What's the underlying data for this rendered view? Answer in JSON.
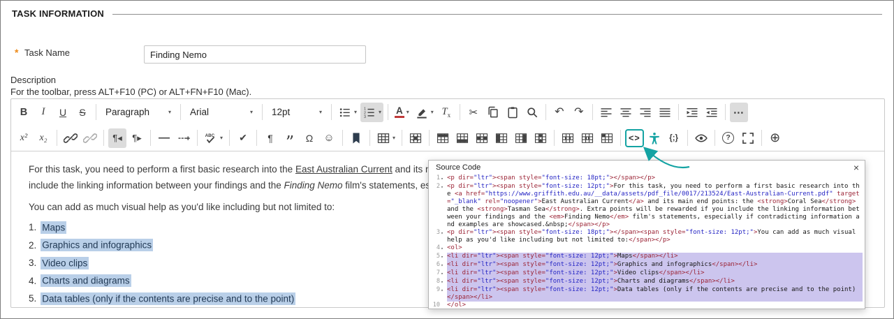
{
  "colors": {
    "teal": "#14a3a3",
    "selection_blue": "#b9cfe8",
    "selection_lavender": "#ccc5ee",
    "asterisk": "#ed8a19",
    "code_tag": "#9b2335",
    "code_string": "#2525c4"
  },
  "header": {
    "title": "TASK INFORMATION"
  },
  "task_name": {
    "required_mark": "*",
    "label": "Task Name",
    "value": "Finding Nemo"
  },
  "description": {
    "label": "Description",
    "toolbar_hint": "For the toolbar, press ALT+F10 (PC) or ALT+FN+F10 (Mac)."
  },
  "toolbar": {
    "row1": [
      {
        "name": "bold-button",
        "glyph": "B",
        "cls": "bold"
      },
      {
        "name": "italic-button",
        "glyph": "I",
        "cls": "italic"
      },
      {
        "name": "underline-button",
        "glyph": "U",
        "cls": "underline"
      },
      {
        "name": "strikethrough-button",
        "glyph": "S",
        "cls": "strike"
      },
      {
        "divider": true
      },
      {
        "name": "paragraph-format-select",
        "label": "Paragraph",
        "select": true
      },
      {
        "divider": true
      },
      {
        "name": "font-family-select",
        "label": "Arial",
        "select": true
      },
      {
        "divider": true
      },
      {
        "name": "font-size-select",
        "label": "12pt",
        "select": true
      },
      {
        "divider": true
      },
      {
        "name": "bullet-list-button",
        "icon": "ul",
        "dropdown": true
      },
      {
        "name": "numbered-list-button",
        "icon": "ol",
        "dropdown": true,
        "active": true
      },
      {
        "divider": true
      },
      {
        "name": "text-color-button",
        "glyph": "A",
        "cls": "textcolor",
        "dropdown": true
      },
      {
        "name": "highlight-color-button",
        "icon": "highlight",
        "dropdown": true
      },
      {
        "name": "clear-formatting-button",
        "glyph": "T",
        "sub": "x",
        "cls": "clearfmt"
      },
      {
        "divider": true
      },
      {
        "name": "cut-button",
        "glyph": "✂",
        "cls": "scissors"
      },
      {
        "name": "copy-button",
        "icon": "copy"
      },
      {
        "name": "paste-button",
        "icon": "paste"
      },
      {
        "name": "search-button",
        "icon": "search"
      },
      {
        "divider": true
      },
      {
        "name": "undo-button",
        "glyph": "↶",
        "cls": "arrowg"
      },
      {
        "name": "redo-button",
        "glyph": "↷",
        "cls": "arrowg"
      },
      {
        "divider": true
      },
      {
        "name": "align-left-button",
        "icon": "alignleft"
      },
      {
        "name": "align-center-button",
        "icon": "aligncenter"
      },
      {
        "name": "align-right-button",
        "icon": "alignright"
      },
      {
        "name": "align-justify-button",
        "icon": "alignjustify"
      },
      {
        "divider": true
      },
      {
        "name": "indent-button",
        "icon": "indent"
      },
      {
        "name": "outdent-button",
        "icon": "outdent"
      },
      {
        "divider": true
      },
      {
        "name": "more-toolbar-button",
        "glyph": "⋯",
        "cls": "more",
        "active": true
      }
    ],
    "row2": [
      {
        "name": "superscript-button",
        "glyph": "x²",
        "cls": "formula"
      },
      {
        "name": "subscript-button",
        "glyph": "x₂",
        "cls": "formula"
      },
      {
        "divider": true
      },
      {
        "name": "insert-link-button",
        "icon": "link"
      },
      {
        "name": "remove-link-button",
        "icon": "unlink",
        "cls": "disabled"
      },
      {
        "divider": true
      },
      {
        "name": "ltr-direction-button",
        "glyph": "¶◂",
        "cls": "dir",
        "active": true
      },
      {
        "name": "rtl-direction-button",
        "glyph": "¶▸",
        "cls": "dir"
      },
      {
        "divider": true
      },
      {
        "name": "horizontal-rule-button",
        "glyph": "—",
        "cls": "hrline"
      },
      {
        "name": "page-break-button",
        "icon": "pagebreak"
      },
      {
        "divider": true
      },
      {
        "name": "spellcheck-button",
        "icon": "spellcheck",
        "dropdown": true
      },
      {
        "divider": true
      },
      {
        "name": "checkmark-button",
        "glyph": "✔"
      },
      {
        "divider": true
      },
      {
        "name": "show-invisibles-button",
        "glyph": "¶"
      },
      {
        "name": "blockquote-button",
        "glyph": "”",
        "cls": "quote"
      },
      {
        "name": "special-character-button",
        "glyph": "Ω"
      },
      {
        "name": "emoticon-button",
        "glyph": "☺",
        "cls": "smiley"
      },
      {
        "divider": true
      },
      {
        "name": "anchor-button",
        "icon": "bookmark",
        "cls": "inkdark"
      },
      {
        "divider": true
      },
      {
        "name": "table-button",
        "icon": "table",
        "dropdown": true
      },
      {
        "divider": true
      },
      {
        "name": "delete-table-button",
        "icon": "tabledel"
      },
      {
        "divider": true
      },
      {
        "name": "insert-row-above-button",
        "icon": "rowabove"
      },
      {
        "name": "insert-row-below-button",
        "icon": "rowbelow"
      },
      {
        "name": "delete-row-button",
        "icon": "rowdel"
      },
      {
        "name": "insert-column-before-button",
        "icon": "colbefore"
      },
      {
        "name": "insert-column-after-button",
        "icon": "colafter"
      },
      {
        "name": "delete-column-button",
        "icon": "coldel"
      },
      {
        "divider": true
      },
      {
        "name": "merge-cells-button",
        "icon": "merge"
      },
      {
        "name": "split-cell-button",
        "icon": "split"
      },
      {
        "name": "cell-properties-button",
        "icon": "cellprops"
      },
      {
        "divider": true
      },
      {
        "name": "source-code-button",
        "glyph": "<>",
        "cls": "srccode",
        "teal": true
      },
      {
        "name": "accessibility-checker-button",
        "icon": "person",
        "cls": "teal-icon"
      },
      {
        "name": "code-sample-button",
        "glyph": "{;}",
        "cls": "codesample"
      },
      {
        "divider": true
      },
      {
        "name": "preview-button",
        "icon": "eye"
      },
      {
        "divider": true
      },
      {
        "name": "help-button",
        "glyph": "?",
        "cls": "circled"
      },
      {
        "name": "fullscreen-button",
        "icon": "fullscreen"
      },
      {
        "divider": true
      },
      {
        "name": "insert-button",
        "glyph": "⊕",
        "cls": "big"
      }
    ]
  },
  "editor_content": {
    "paragraph1_line1": [
      {
        "t": "For this task, you need to perform a first basic research into the "
      },
      {
        "t": "East Australian Current",
        "s": "link"
      },
      {
        "t": " and its main end points: the "
      },
      {
        "t": "Coral Sea",
        "s": "bold"
      },
      {
        "t": " and the "
      },
      {
        "t": "Tasman Sea",
        "s": "bold"
      },
      {
        "t": ". Extra points will be rewarded if you"
      }
    ],
    "paragraph1_line2": [
      {
        "t": "include the linking information between your findings and the "
      },
      {
        "t": "Finding Nemo",
        "s": "italic"
      },
      {
        "t": " film's statements, especially if contradicting information and examples are showcased."
      }
    ],
    "paragraph2": "You can add as much visual help as you'd like including but not limited to:",
    "list": [
      {
        "num": "1.",
        "text": "Maps"
      },
      {
        "num": "2.",
        "text": "Graphics and infographics"
      },
      {
        "num": "3.",
        "text": "Video clips"
      },
      {
        "num": "4.",
        "text": "Charts and diagrams"
      },
      {
        "num": "5.",
        "text": "Data tables (only if the contents are precise and to the point)"
      }
    ]
  },
  "source_code_panel": {
    "title": "Source Code",
    "close_label": "×",
    "lines": [
      {
        "n": 1,
        "fold": true,
        "selected": false,
        "code": "<p dir=\"ltr\"><span style=\"font-size: 18pt;\"></span></p>"
      },
      {
        "n": 2,
        "fold": true,
        "selected": false,
        "code": "<p dir=\"ltr\"><span style=\"font-size: 12pt;\">For this task, you need to perform a first basic research into the <a href=\"https://www.griffith.edu.au/__data/assets/pdf_file/0017/213524/East-Australian-Current.pdf\" target=\"_blank\" rel=\"noopener\">East Australian Current</a> and its main end points: the <strong>Coral Sea</strong> and the <strong>Tasman Sea</strong>. Extra points will be rewarded if you include the linking information between your findings and the <em>Finding Nemo</em> film's statements, especially if contradicting information and examples are showcased.&nbsp;</span></p>"
      },
      {
        "n": 3,
        "fold": true,
        "selected": false,
        "code": "<p dir=\"ltr\"><span style=\"font-size: 18pt;\"></span><span style=\"font-size: 12pt;\">You can add as much visual help as you'd like including but not limited to:</span></p>"
      },
      {
        "n": 4,
        "fold": true,
        "selected": false,
        "code": "<ol>"
      },
      {
        "n": 5,
        "fold": true,
        "selected": true,
        "code": "<li dir=\"ltr\"><span style=\"font-size: 12pt;\">Maps</span></li>"
      },
      {
        "n": 6,
        "fold": true,
        "selected": true,
        "code": "<li dir=\"ltr\"><span style=\"font-size: 12pt;\">Graphics and infographics</span></li>"
      },
      {
        "n": 7,
        "fold": true,
        "selected": true,
        "code": "<li dir=\"ltr\"><span style=\"font-size: 12pt;\">Video clips</span></li>"
      },
      {
        "n": 8,
        "fold": true,
        "selected": true,
        "code": "<li dir=\"ltr\"><span style=\"font-size: 12pt;\">Charts and diagrams</span></li>"
      },
      {
        "n": 9,
        "fold": true,
        "selected": true,
        "code": "<li dir=\"ltr\"><span style=\"font-size: 12pt;\">Data tables (only if the contents are precise and to the point)</span></li>"
      },
      {
        "n": 10,
        "fold": false,
        "selected": false,
        "code": "</ol>"
      }
    ]
  }
}
